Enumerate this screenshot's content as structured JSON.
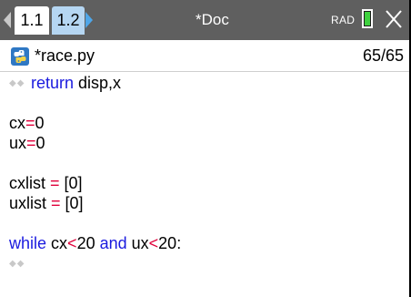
{
  "topbar": {
    "tabs": [
      {
        "label": "1.1"
      },
      {
        "label": "1.2"
      }
    ],
    "doc_title": "*Doc",
    "angle_mode": "RAD",
    "battery_icon": "battery-icon",
    "close_icon": "close-icon"
  },
  "file": {
    "icon": "python-icon",
    "name": "*race.py",
    "line_counter": "65/65"
  },
  "code": {
    "line1": {
      "indent": "◆◆",
      "kw": "return",
      "rest": " disp,x"
    },
    "line3": {
      "a": "cx",
      "op": "=",
      "b": "0"
    },
    "line4": {
      "a": "ux",
      "op": "=",
      "b": "0"
    },
    "line6": {
      "a": "cxlist ",
      "op": "=",
      "b": " [0]"
    },
    "line7": {
      "a": "uxlist ",
      "op": "=",
      "b": " [0]"
    },
    "line9": {
      "kw1": "while",
      "p1": " cx",
      "op1": "<",
      "p2": "20 ",
      "kw2": "and",
      "p3": " ux",
      "op2": "<",
      "p4": "20:"
    },
    "line10": {
      "indent": "◆◆"
    }
  },
  "colors": {
    "topbar_bg": "#5f5f5f",
    "active_tab_bg": "#ffffff",
    "inactive_tab_bg": "#b5d6f2",
    "keyword": "#1a1adf",
    "operator": "#e0003a",
    "battery_fill": "#3fd13f"
  }
}
